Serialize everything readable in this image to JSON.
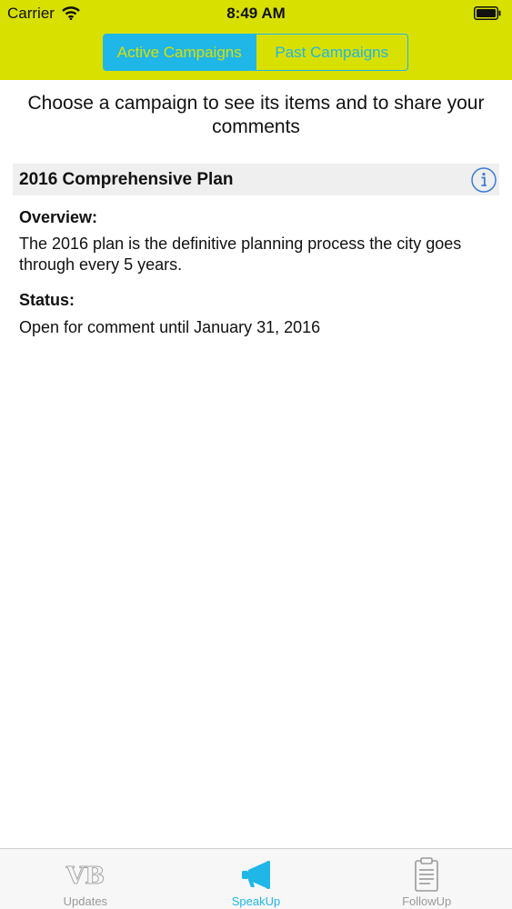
{
  "status_bar": {
    "carrier": "Carrier",
    "time": "8:49 AM"
  },
  "segmented": {
    "active_label": "Active Campaigns",
    "past_label": "Past Campaigns"
  },
  "intro_text": "Choose a campaign to see its items and to share your comments",
  "campaign": {
    "title": "2016 Comprehensive Plan",
    "overview_label": "Overview:",
    "overview_text": "The 2016 plan is the definitive planning process the city goes through every 5 years.",
    "status_label": "Status:",
    "status_text": "Open for comment until January 31, 2016"
  },
  "tabbar": {
    "tabs": [
      {
        "label": "Updates",
        "icon": "vb-logo-icon"
      },
      {
        "label": "SpeakUp",
        "icon": "megaphone-icon",
        "active": true
      },
      {
        "label": "FollowUp",
        "icon": "clipboard-icon"
      }
    ]
  },
  "colors": {
    "header_bg": "#d8e000",
    "accent": "#1fb6e8"
  }
}
